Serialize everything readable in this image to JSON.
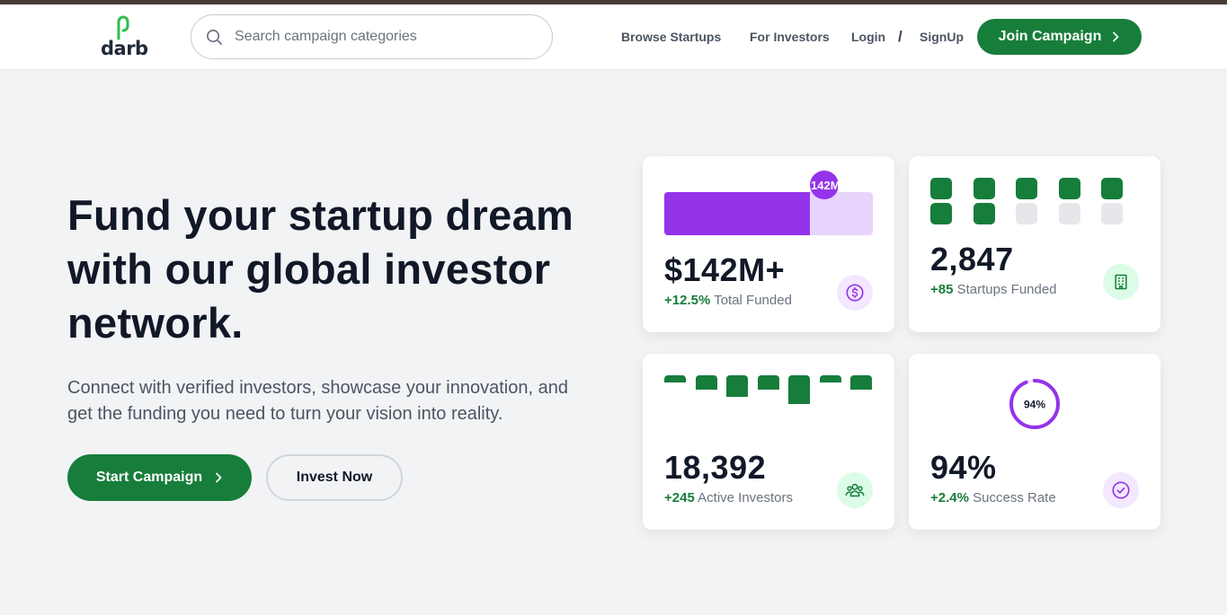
{
  "brand": {
    "name": "darb",
    "color": "#177d3b"
  },
  "search": {
    "placeholder": "Search campaign categories",
    "icon": "search-icon"
  },
  "nav": {
    "links": [
      "Browse Startups",
      "For Investors",
      "Login",
      "SignUp"
    ],
    "separator": "/",
    "join_label": "Join Campaign",
    "join_icon": "chevron-right-icon"
  },
  "hero": {
    "title": "Fund your startup dream with our global investor network.",
    "subtitle": "Connect with verified investors, showcase your innovation, and get the funding you need to turn your vision into reality.",
    "start_label": "Start Campaign",
    "invest_label": "Invest Now"
  },
  "stats": [
    {
      "value": "$142M+",
      "delta": "+12.5%",
      "label": "Total Funded",
      "icon": "dollar-icon",
      "badge": "142M",
      "progress": 0.7
    },
    {
      "value": "2,847",
      "delta": "+85",
      "label": "Startups Funded",
      "icon": "building-icon",
      "grid_filled": 7,
      "grid_total": 10
    },
    {
      "value": "18,392",
      "delta": "+245",
      "label": "Active Investors",
      "icon": "users-icon",
      "bars": [
        1,
        2,
        3,
        2,
        4,
        1,
        2
      ]
    },
    {
      "value": "94%",
      "delta": "+2.4%",
      "label": "Success Rate",
      "icon": "check-circle-icon",
      "ring_label": "94%",
      "ring_progress": 0.94
    }
  ],
  "colors": {
    "green": "#177d3b",
    "purple": "#9333ea",
    "light_purple": "#e8d3fc",
    "light_green": "#dcfce7",
    "grey_square": "#e5e7eb"
  }
}
